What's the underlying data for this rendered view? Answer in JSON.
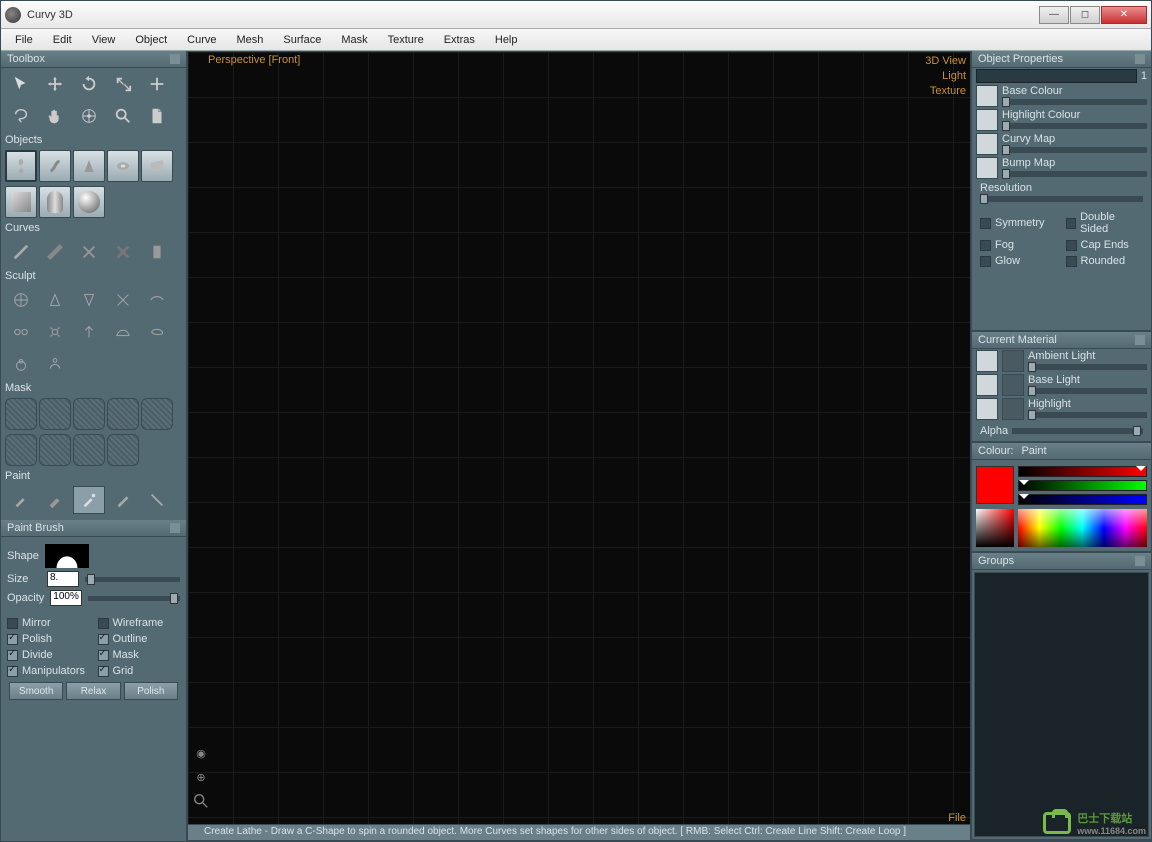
{
  "app": {
    "title": "Curvy 3D"
  },
  "menu": [
    "File",
    "Edit",
    "View",
    "Object",
    "Curve",
    "Mesh",
    "Surface",
    "Mask",
    "Texture",
    "Extras",
    "Help"
  ],
  "toolbox": {
    "title": "Toolbox",
    "sections": {
      "objects": "Objects",
      "curves": "Curves",
      "sculpt": "Sculpt",
      "mask": "Mask",
      "paint": "Paint"
    }
  },
  "viewport": {
    "label": "Perspective [Front]",
    "right": [
      "3D View",
      "Light",
      "Texture"
    ],
    "file": "File",
    "status": "Create Lathe - Draw a C-Shape to spin a rounded object. More Curves set shapes for other sides of object. [ RMB: Select   Ctrl: Create Line   Shift: Create Loop ]"
  },
  "paint_brush": {
    "title": "Paint Brush",
    "shape_label": "Shape",
    "size_label": "Size",
    "size_value": "8.",
    "opacity_label": "Opacity",
    "opacity_value": "100%",
    "checks": [
      {
        "label": "Mirror",
        "on": false
      },
      {
        "label": "Wireframe",
        "on": false
      },
      {
        "label": "Polish",
        "on": true
      },
      {
        "label": "Outline",
        "on": true
      },
      {
        "label": "Divide",
        "on": true
      },
      {
        "label": "Mask",
        "on": true
      },
      {
        "label": "Manipulators",
        "on": true
      },
      {
        "label": "Grid",
        "on": true
      }
    ],
    "actions": [
      "Smooth",
      "Relax",
      "Polish"
    ]
  },
  "object_properties": {
    "title": "Object Properties",
    "value": "1",
    "props": [
      "Base Colour",
      "Highlight Colour",
      "Curvy Map",
      "Bump Map",
      "Resolution"
    ],
    "checks": [
      {
        "label": "Symmetry"
      },
      {
        "label": "Double Sided"
      },
      {
        "label": "Fog"
      },
      {
        "label": "Cap Ends"
      },
      {
        "label": "Glow"
      },
      {
        "label": "Rounded"
      }
    ]
  },
  "current_material": {
    "title": "Current Material",
    "props": [
      "Ambient Light",
      "Base Light",
      "Highlight"
    ],
    "alpha_label": "Alpha"
  },
  "colour": {
    "title": "Colour:",
    "mode": "Paint",
    "hex": "#ff0000"
  },
  "groups": {
    "title": "Groups"
  },
  "watermark": {
    "main": "巴士下载站",
    "sub": "www.11684.com"
  }
}
